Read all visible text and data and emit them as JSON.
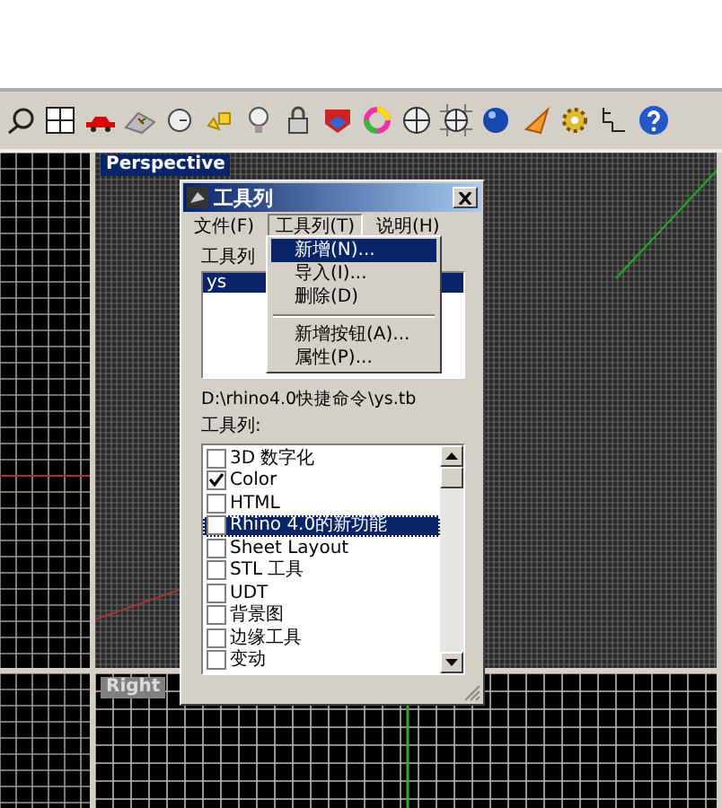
{
  "viewports": [
    {
      "label": "Perspective"
    },
    {
      "label": "Right"
    }
  ],
  "dialog": {
    "title": "工具列",
    "menu_bar": [
      {
        "label": "文件(F)",
        "selected": false
      },
      {
        "label": "工具列(T)",
        "selected": true
      },
      {
        "label": "说明(H)",
        "selected": false
      }
    ],
    "files_label": "工具列",
    "files": [
      {
        "label": "ys",
        "selected": true
      }
    ],
    "path": "D:\\rhino4.0快捷命令\\ys.tb",
    "toolbars_label": "工具列:",
    "toolbars": [
      {
        "label": "3D 数字化",
        "checked": false,
        "selected": false
      },
      {
        "label": "Color",
        "checked": true,
        "selected": false
      },
      {
        "label": "HTML",
        "checked": false,
        "selected": false
      },
      {
        "label": "Rhino 4.0的新功能",
        "checked": false,
        "selected": true
      },
      {
        "label": "Sheet Layout",
        "checked": false,
        "selected": false
      },
      {
        "label": "STL 工具",
        "checked": false,
        "selected": false
      },
      {
        "label": "UDT",
        "checked": false,
        "selected": false
      },
      {
        "label": "背景图",
        "checked": false,
        "selected": false
      },
      {
        "label": "边缘工具",
        "checked": false,
        "selected": false
      },
      {
        "label": "变动",
        "checked": false,
        "selected": false
      }
    ]
  },
  "dropdown": [
    [
      {
        "label": "新增(N)...",
        "selected": true
      },
      {
        "label": "导入(I)...",
        "selected": false
      },
      {
        "label": "删除(D)",
        "selected": false
      }
    ],
    [
      {
        "label": "新增按钮(A)...",
        "selected": false
      },
      {
        "label": "属性(P)...",
        "selected": false
      }
    ]
  ]
}
